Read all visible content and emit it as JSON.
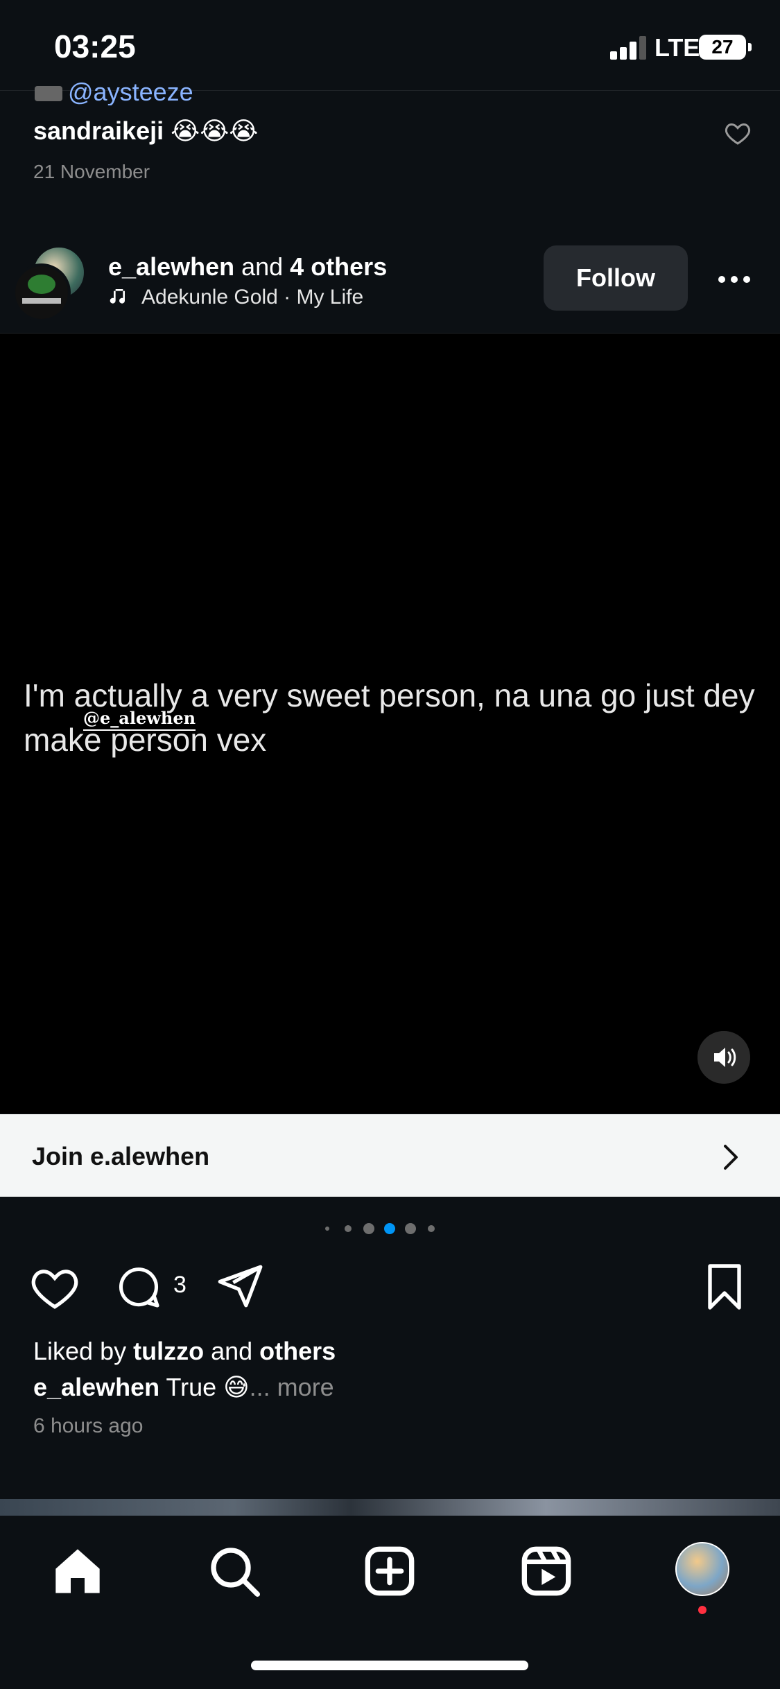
{
  "status_bar": {
    "time": "03:25",
    "network": "LTE",
    "battery": "27"
  },
  "previous_post": {
    "credit": "@aysteeze",
    "caption_user": "sandraikeji",
    "caption_emojis": "😭😭😭",
    "date": "21 November"
  },
  "post": {
    "author_primary": "e_alewhen",
    "author_joiner": " and ",
    "author_others": "4 others",
    "music": "Adekunle Gold · My Life",
    "follow_label": "Follow",
    "video_text": "I'm actually a very sweet person, na una go just dey make person vex",
    "video_tag": "@e_alewhen",
    "join_label": "Join e.alewhen",
    "comment_count": "3",
    "liked_by_prefix": "Liked by ",
    "liked_by_user": "tulzzo",
    "liked_by_joiner": " and ",
    "liked_by_others": "others",
    "caption_user": "e_alewhen",
    "caption_text": " True 😅",
    "caption_more": "... more",
    "time_ago": "6 hours ago"
  },
  "pager": {
    "count": 6,
    "active_index": 3,
    "active_color": "#0095f6"
  },
  "colors": {
    "background": "#0c1014",
    "notification_dot": "#ff3040"
  },
  "icons": {
    "like": "heart-icon",
    "comment": "comment-icon",
    "share": "send-icon",
    "save": "bookmark-icon",
    "home": "home-icon",
    "search": "search-icon",
    "create": "plus-square-icon",
    "reels": "reels-icon",
    "volume": "volume-icon",
    "music": "music-note-icon",
    "more": "more-horizontal-icon"
  }
}
